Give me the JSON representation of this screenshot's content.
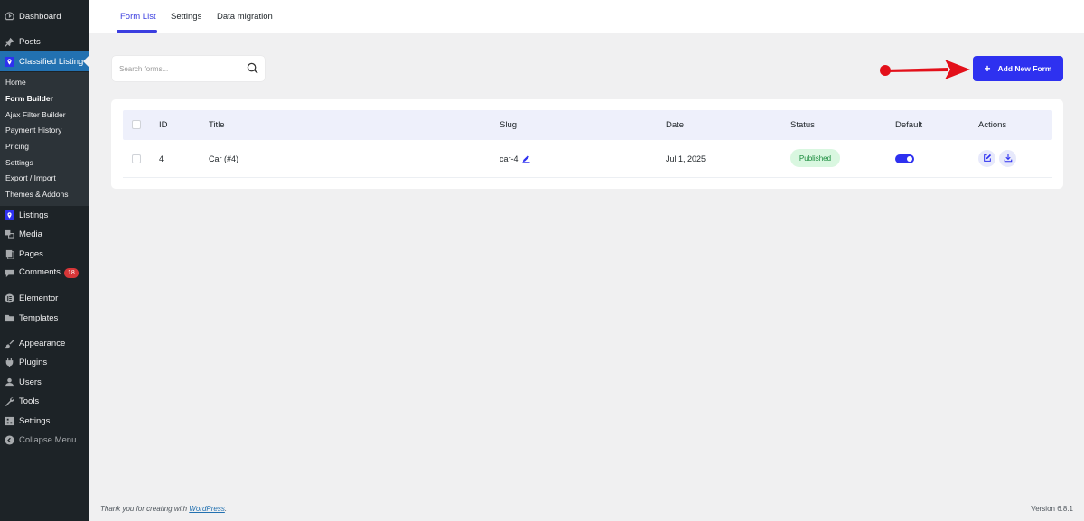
{
  "sidebar": {
    "dashboard": "Dashboard",
    "posts": "Posts",
    "classified_listing": "Classified Listing",
    "submenu": [
      "Home",
      "Form Builder",
      "Ajax Filter Builder",
      "Payment History",
      "Pricing",
      "Settings",
      "Export / Import",
      "Themes & Addons"
    ],
    "listings": "Listings",
    "media": "Media",
    "pages": "Pages",
    "comments": "Comments",
    "comments_badge": "18",
    "elementor": "Elementor",
    "templates": "Templates",
    "appearance": "Appearance",
    "plugins": "Plugins",
    "users": "Users",
    "tools": "Tools",
    "settings": "Settings",
    "collapse": "Collapse Menu"
  },
  "tabs": [
    "Form List",
    "Settings",
    "Data migration"
  ],
  "search": {
    "placeholder": "Search forms..."
  },
  "add_button": {
    "label": "Add New Form"
  },
  "table": {
    "headers": [
      "ID",
      "Title",
      "Slug",
      "Date",
      "Status",
      "Default",
      "Actions"
    ],
    "rows": [
      {
        "id": "4",
        "title": "Car (#4)",
        "slug": "car-4",
        "date": "Jul 1, 2025",
        "status": "Published",
        "default": true
      }
    ]
  },
  "footer": {
    "thank_you_prefix": "Thank you for creating with ",
    "wordpress_link": "WordPress",
    "thank_you_suffix": ".",
    "version": "Version 6.8.1"
  },
  "colors": {
    "accent": "#2e31f0",
    "sidebar_bg": "#1d2327",
    "active_menu": "#2271b1",
    "status_bg": "#d9f7e0",
    "status_text": "#168a3a",
    "annotation_arrow": "#e3101a"
  },
  "icons": {
    "dashboard": "dashboard-icon",
    "posts": "pushpin-icon",
    "classified_listing": "location-pin-icon",
    "listings": "location-pin-icon",
    "media": "media-icon",
    "pages": "pages-icon",
    "comments": "comment-icon",
    "elementor": "elementor-icon",
    "templates": "folder-icon",
    "appearance": "paintbrush-icon",
    "plugins": "plug-icon",
    "users": "user-icon",
    "tools": "wrench-icon",
    "settings": "settings-icon",
    "collapse": "collapse-icon",
    "search": "search-icon",
    "add": "plus-icon",
    "edit": "edit-icon",
    "download": "download-icon"
  }
}
